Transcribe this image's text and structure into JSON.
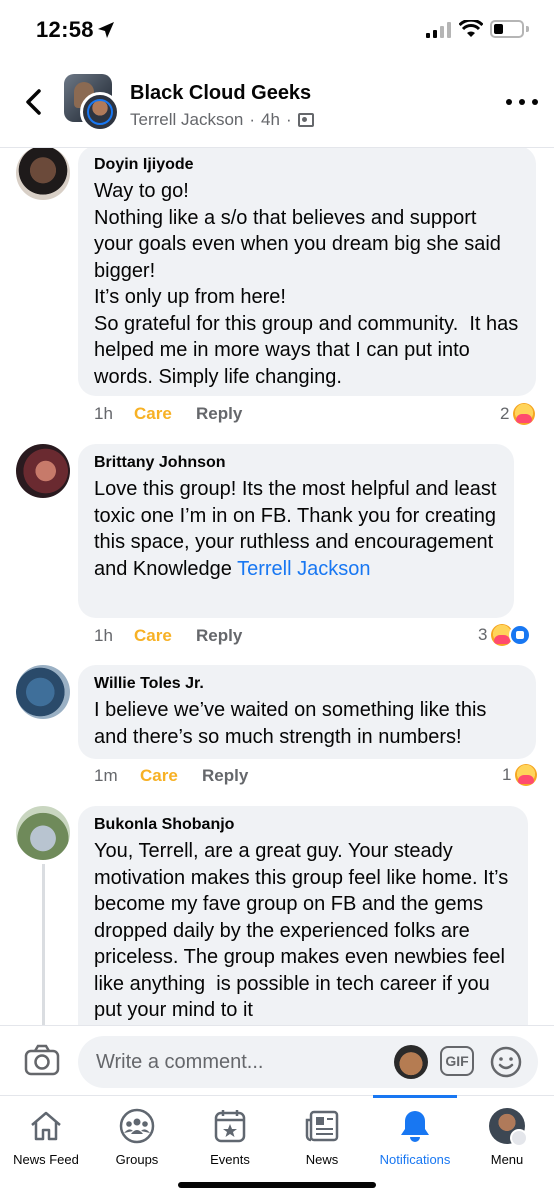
{
  "status_bar": {
    "time": "12:58"
  },
  "header": {
    "group_name": "Black Cloud Geeks",
    "poster_name": "Terrell Jackson",
    "meta_separator": "·",
    "post_time": "4h",
    "meta_separator_2": "·"
  },
  "comments": [
    {
      "author": "Doyin Ijiyode",
      "text": "Way to go!\nNothing like a s/o that believes and support your goals even when you dream big she said bigger!\nIt’s only up from here!\nSo grateful for this group and community.  It has helped me in more ways that I can put into words. Simply life changing.",
      "time": "1h",
      "reaction_label": "Care",
      "reply_label": "Reply",
      "reaction_count": "2"
    },
    {
      "author": "Brittany Johnson",
      "text": "Love this group! Its the most helpful and least toxic one I’m in on FB. Thank you for creating this space, your ruthless and encouragement and Knowledge ",
      "mention": "Terrell Jackson",
      "time": "1h",
      "reaction_label": "Care",
      "reply_label": "Reply",
      "reaction_count": "3"
    },
    {
      "author": "Willie Toles Jr.",
      "text": "I believe we’ve waited on something like this and there’s so much strength in numbers!",
      "time": "1m",
      "reaction_label": "Care",
      "reply_label": "Reply",
      "reaction_count": "1"
    },
    {
      "author": "Bukonla Shobanjo",
      "text": "You, Terrell, are a great guy. Your steady motivation makes this group feel like home. It’s become my fave group on FB and the gems dropped daily by the experienced folks are priceless. The group makes even newbies feel like anything  is possible in tech career if you put your mind to it"
    }
  ],
  "composer": {
    "placeholder": "Write a comment...",
    "gif_label": "GIF"
  },
  "bottom_nav": [
    {
      "label": "News Feed",
      "icon": "home-icon"
    },
    {
      "label": "Groups",
      "icon": "groups-icon"
    },
    {
      "label": "Events",
      "icon": "events-icon"
    },
    {
      "label": "News",
      "icon": "news-icon"
    },
    {
      "label": "Notifications",
      "icon": "bell-icon",
      "active": true
    },
    {
      "label": "Menu",
      "icon": "profile-avatar"
    }
  ],
  "colors": {
    "accent": "#1877f2",
    "care": "#f7b125",
    "bubble": "#f0f2f5",
    "secondary_text": "#65676b"
  }
}
